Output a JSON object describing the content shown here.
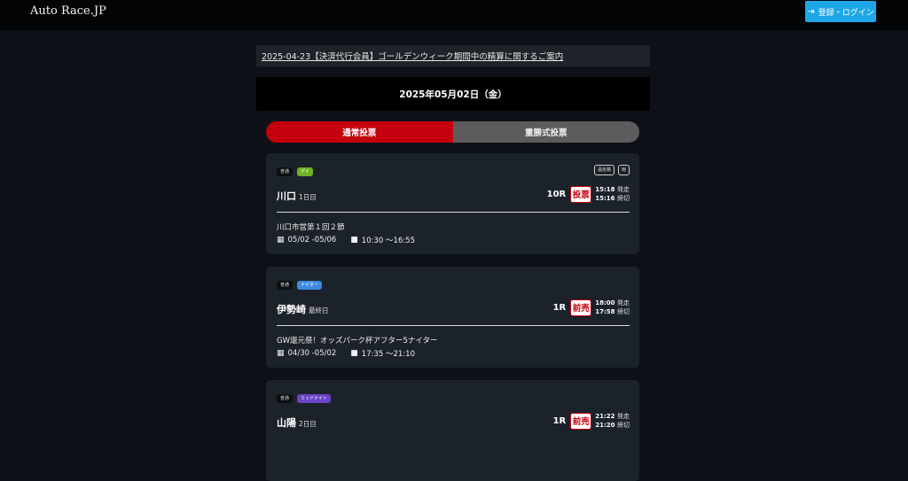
{
  "header": {
    "logo": "Auto Race.JP",
    "login_label": "登録・ログイン",
    "login_icon": "sign-in-icon"
  },
  "notice": {
    "text": "2025-04-23【決済代行会員】ゴールデンウィーク期間中の精算に関するご案内"
  },
  "date_label": "2025年05月02日（金）",
  "tabs": [
    {
      "label": "通常投票",
      "active": true
    },
    {
      "label": "重勝式投票",
      "active": false
    }
  ],
  "cards": [
    {
      "grade": "普通",
      "session": "デイ",
      "tags": [
        "温走路",
        "雨"
      ],
      "venue": "川口",
      "day": "1日目",
      "race_no": "10R",
      "button": "投票",
      "start_time": "15:18",
      "start_label": "発走",
      "close_time": "15:16",
      "close_label": "締切",
      "title": "川口市営第１回２節",
      "dates": "05/02 -05/06",
      "hours": "10:30 〜16:55"
    },
    {
      "grade": "普通",
      "session": "ナイター",
      "tags": [],
      "venue": "伊勢崎",
      "day": "最終日",
      "race_no": "1R",
      "button": "前売",
      "start_time": "18:00",
      "start_label": "発走",
      "close_time": "17:58",
      "close_label": "締切",
      "title": "GW還元祭！オッズパーク杯アフター5ナイター",
      "dates": "04/30 -05/02",
      "hours": "17:35 〜21:10"
    },
    {
      "grade": "普通",
      "session": "ミッドナイト",
      "tags": [],
      "venue": "山陽",
      "day": "2日目",
      "race_no": "1R",
      "button": "前売",
      "start_time": "21:22",
      "start_label": "発走",
      "close_time": "21:20",
      "close_label": "締切"
    }
  ]
}
